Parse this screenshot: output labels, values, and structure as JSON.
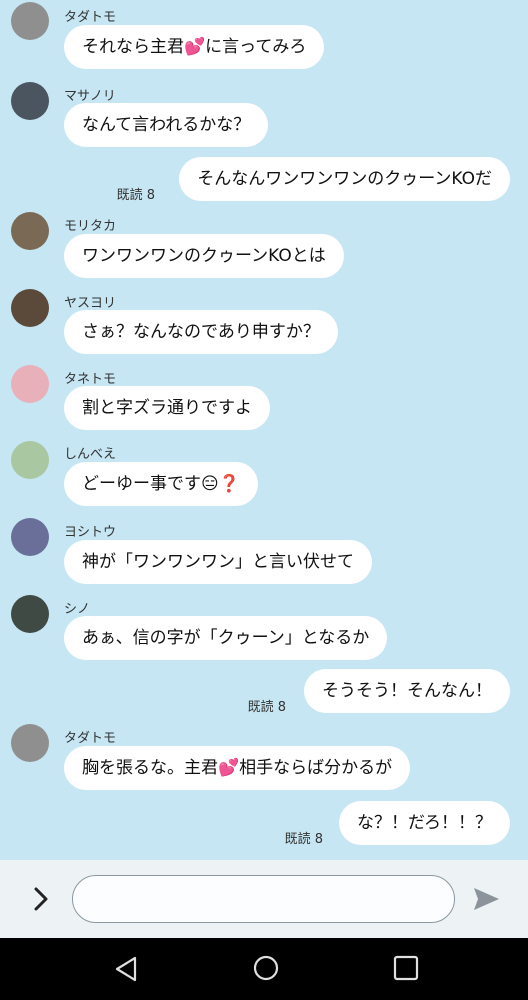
{
  "messages": [
    {
      "id": "m1",
      "dir": "in",
      "sender": "タダトモ",
      "avatar_color": "#8f8f8f",
      "text": "それなら主君💕に言ってみろ"
    },
    {
      "id": "m2",
      "dir": "in",
      "sender": "マサノリ",
      "avatar_color": "#4a5560",
      "text": "なんて言われるかな？"
    },
    {
      "id": "m3",
      "dir": "out",
      "read": "既読 8",
      "text": "そんなんワンワンワンのクゥーンKOだ"
    },
    {
      "id": "m4",
      "dir": "in",
      "sender": "モリタカ",
      "avatar_color": "#7a6a55",
      "text": "ワンワンワンのクゥーンKOとは"
    },
    {
      "id": "m5",
      "dir": "in",
      "sender": "ヤスヨリ",
      "avatar_color": "#5b4a3a",
      "text": "さぁ？なんなのであり申すか？"
    },
    {
      "id": "m6",
      "dir": "in",
      "sender": "タネトモ",
      "avatar_color": "#e8b0b8",
      "text": "割と字ズラ通りですよ"
    },
    {
      "id": "m7",
      "dir": "in",
      "sender": "しんべえ",
      "avatar_color": "#a9c7a0",
      "text": "どーゆー事です😑❓"
    },
    {
      "id": "m8",
      "dir": "in",
      "sender": "ヨシトウ",
      "avatar_color": "#6a6f9a",
      "text": "神が「ワンワンワン」と言い伏せて"
    },
    {
      "id": "m9",
      "dir": "in",
      "sender": "シノ",
      "avatar_color": "#3f4a45",
      "text": "あぁ、信の字が「クゥーン」となるか"
    },
    {
      "id": "m10",
      "dir": "out",
      "read": "既読 8",
      "text": "そうそう！そんなん！"
    },
    {
      "id": "m11",
      "dir": "in",
      "sender": "タダトモ",
      "avatar_color": "#8f8f8f",
      "text": "胸を張るな。主君💕相手ならば分かるが"
    },
    {
      "id": "m12",
      "dir": "out",
      "read": "既読 8",
      "text": "な？！だろ！！？"
    }
  ],
  "input": {
    "placeholder": "",
    "value": ""
  },
  "icons": {
    "expand": "chevron-right-icon",
    "send": "send-icon",
    "back": "nav-back-icon",
    "home": "nav-home-icon",
    "recents": "nav-recents-icon"
  },
  "colors": {
    "background": "#c6e6f3",
    "bubble": "#ffffff",
    "input_bar": "#edf2f5",
    "nav_bar": "#000000"
  }
}
